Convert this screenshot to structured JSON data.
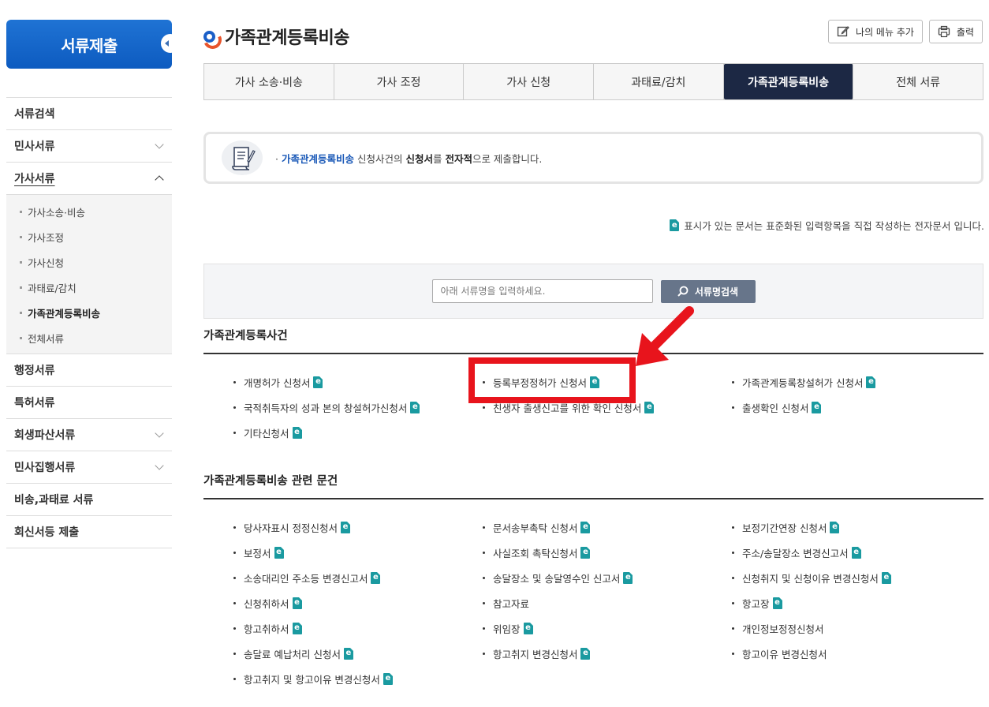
{
  "sidebar": {
    "title": "서류제출",
    "items": [
      {
        "label": "서류검색",
        "chevron": false
      },
      {
        "label": "민사서류",
        "chevron": true
      },
      {
        "label": "가사서류",
        "chevron": true
      },
      {
        "label": "행정서류",
        "chevron": false
      },
      {
        "label": "특허서류",
        "chevron": false
      },
      {
        "label": "회생파산서류",
        "chevron": true
      },
      {
        "label": "민사집행서류",
        "chevron": true
      },
      {
        "label": "비송,과태료 서류",
        "chevron": false
      },
      {
        "label": "회신서등 제출",
        "chevron": false
      }
    ],
    "subitems": [
      "가사소송·비송",
      "가사조정",
      "가사신청",
      "과태료/감치",
      "가족관계등록비송",
      "전체서류"
    ],
    "current_subitem": "가족관계등록비송"
  },
  "header": {
    "title": "가족관계등록비송",
    "add_menu_label": "나의 메뉴 추가",
    "print_label": "출력"
  },
  "tabs": [
    "가사 소송·비송",
    "가사 조정",
    "가사 신청",
    "과태료/감치",
    "가족관계등록비송",
    "전체 서류"
  ],
  "active_tab": "가족관계등록비송",
  "info": {
    "bullet": "·",
    "part1": "가족관계등록비송",
    "part2": " 신청사건의 ",
    "part3": "신청서",
    "part4": "를 ",
    "part5": "전자적",
    "part6": "으로 제출합니다."
  },
  "note": "표시가 있는 문서는 표준화된 입력항목을 직접 작성하는 전자문서 입니다.",
  "search": {
    "placeholder": "아래 서류명을 입력하세요.",
    "button_label": "서류명검색"
  },
  "sections": [
    {
      "title": "가족관계등록사건",
      "docs": [
        "개명허가 신청서",
        "등록부정정허가 신청서",
        "가족관계등록창설허가 신청서",
        "국적취득자의 성과 본의 창설허가신청서",
        "친생자 출생신고를 위한 확인 신청서",
        "출생확인 신청서",
        "기타신청서"
      ]
    },
    {
      "title": "가족관계등록비송 관련 문건",
      "docs": [
        "당사자표시 정정신청서",
        "문서송부촉탁 신청서",
        "보정기간연장 신청서",
        "보정서",
        "사실조회 촉탁신청서",
        "주소/송달장소 변경신고서",
        "소송대리인 주소등 변경신고서",
        "송달장소 및 송달영수인 신고서",
        "신청취지 및 신청이유 변경신청서",
        "신청취하서",
        "참고자료",
        "항고장",
        "항고취하서",
        "위임장",
        "개인정보정정신청서",
        "송달료 예납처리 신청서",
        "항고취지 변경신청서",
        "항고이유 변경신청서",
        "항고취지 및 항고이유 변경신청서"
      ],
      "no_e_icon": [
        "참고자료",
        "개인정보정정신청서",
        "항고이유 변경신청서"
      ]
    }
  ],
  "e_icon_letter": "e",
  "colors": {
    "brand_blue": "#0d5bc0",
    "active_tab": "#1c2844",
    "highlight": "#e8141c",
    "e_icon": "#1a9aa0"
  }
}
